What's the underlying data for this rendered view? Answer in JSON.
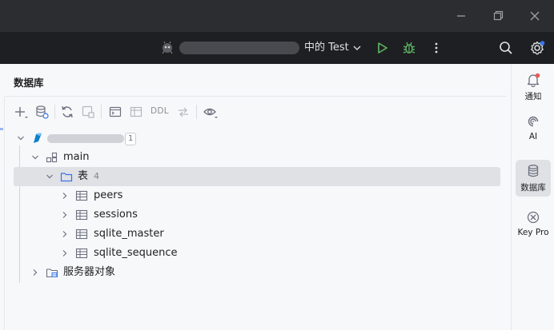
{
  "runbar": {
    "config_label": "中的 Test"
  },
  "panel": {
    "title": "数据库",
    "toolbar": {
      "ddl_label": "DDL"
    }
  },
  "tree": {
    "datasource_badge": "1",
    "schema_label": "main",
    "tables_folder": {
      "label": "表",
      "count": "4"
    },
    "tables": [
      {
        "label": "peers"
      },
      {
        "label": "sessions"
      },
      {
        "label": "sqlite_master"
      },
      {
        "label": "sqlite_sequence"
      }
    ],
    "server_objects_label": "服务器对象"
  },
  "stripe": {
    "items": [
      {
        "label": "通知"
      },
      {
        "label": "AI"
      },
      {
        "label": "数据库"
      },
      {
        "label": "Key Pro"
      }
    ]
  },
  "colors": {
    "accent": "#3574f0",
    "run_green": "#5fb865",
    "notify_dot": "#e55c5c",
    "selection": "#dfe1e5"
  }
}
